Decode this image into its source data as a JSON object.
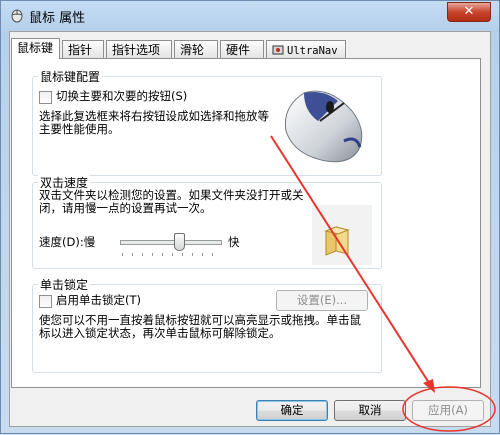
{
  "window": {
    "title": "鼠标 属性",
    "close_label": "✕"
  },
  "tabs": [
    {
      "label": "鼠标键",
      "active": true
    },
    {
      "label": "指针"
    },
    {
      "label": "指针选项"
    },
    {
      "label": "滑轮"
    },
    {
      "label": "硬件"
    },
    {
      "label": "UltraNav"
    }
  ],
  "buttons_group": {
    "title": "鼠标键配置",
    "checkbox_label": "切换主要和次要的按钮(S)",
    "description": "选择此复选框来将右按钮设成如选择和拖放等主要性能使用。"
  },
  "double_click": {
    "title": "双击速度",
    "description": "双击文件夹以检测您的设置。如果文件夹没打开或关闭，请用慢一点的设置再试一次。",
    "speed_label": "速度(D):慢",
    "fast_label": "快",
    "speed_level": 0.58
  },
  "click_lock": {
    "title": "单击锁定",
    "checkbox_label": "启用单击锁定(T)",
    "settings_button": "设置(E)...",
    "description": "使您可以不用一直按着鼠标按钮就可以高亮显示或拖拽。单击鼠标以进入锁定状态，再次单击鼠标可解除锁定。"
  },
  "footer": {
    "ok": "确定",
    "cancel": "取消",
    "apply": "应用(A)"
  },
  "colors": {
    "annotation": "#e8352d"
  }
}
